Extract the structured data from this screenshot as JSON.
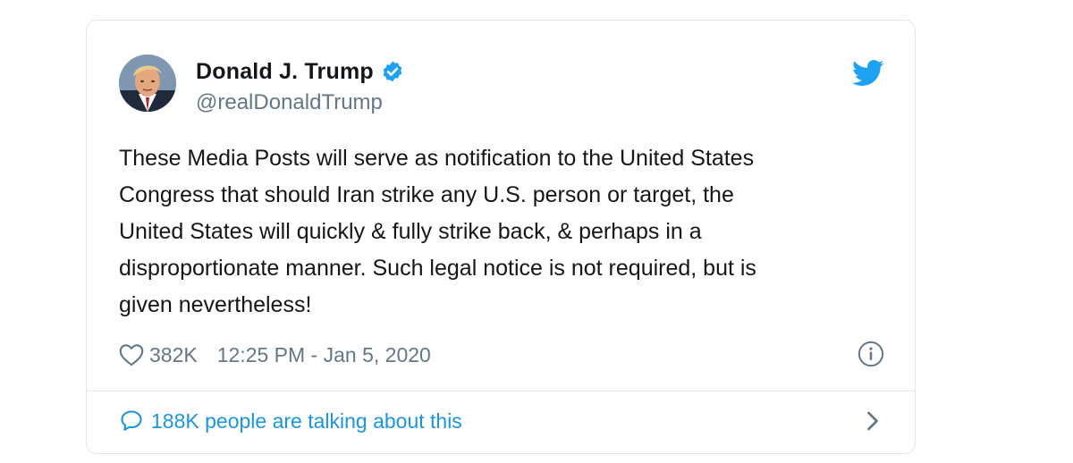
{
  "tweet": {
    "display_name": "Donald J. Trump",
    "handle": "@realDonaldTrump",
    "verified": true,
    "text": "These Media Posts will serve as notification to the United States\nCongress that should Iran strike any U.S. person or target, the\nUnited States will quickly & fully strike back, & perhaps in a\ndisproportionate manner. Such legal notice is not required, but is\ngiven nevertheless!",
    "likes": "382K",
    "timestamp": "12:25 PM - Jan 5, 2020",
    "talking": "188K people are talking about this"
  },
  "icons": {
    "brand": "twitter-bird-icon",
    "verified": "verified-badge-icon",
    "like": "heart-icon",
    "info": "info-icon",
    "conversation": "speech-bubble-icon",
    "chevron": "chevron-right-icon"
  },
  "colors": {
    "twitter_blue": "#1da1f2",
    "link_blue": "#1b95e0",
    "text": "#14171a",
    "secondary_text": "#657786",
    "border": "#e1e8ed"
  }
}
